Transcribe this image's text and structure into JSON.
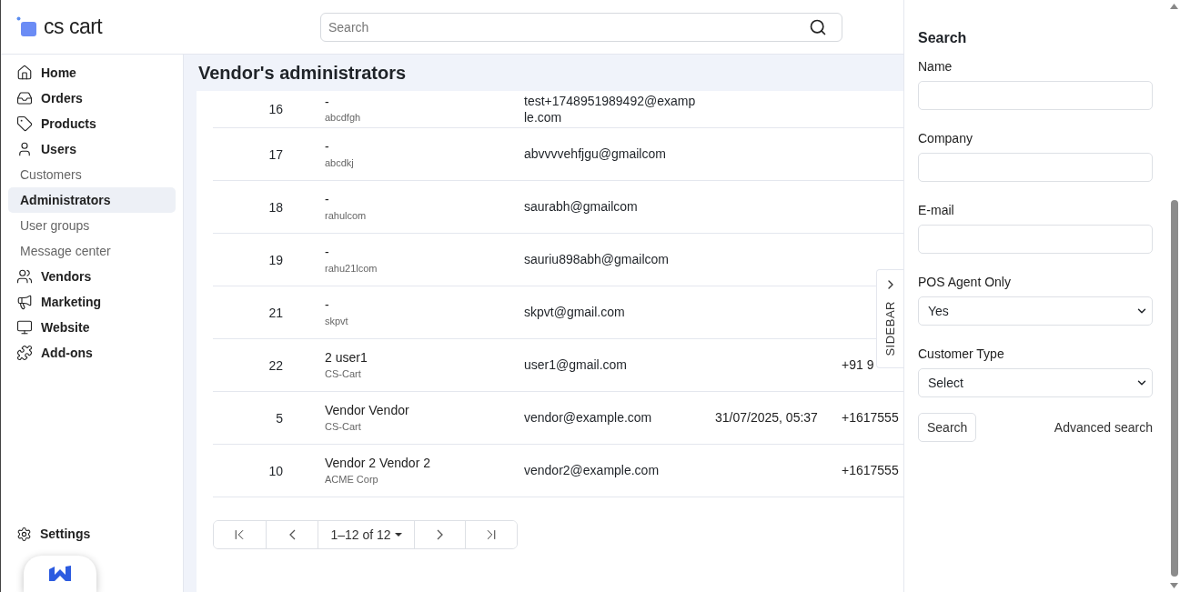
{
  "logo": {
    "text": "cs cart"
  },
  "search": {
    "placeholder": "Search"
  },
  "nav": [
    {
      "label": "Home",
      "kind": "main",
      "selected": false
    },
    {
      "label": "Orders",
      "kind": "main",
      "selected": false
    },
    {
      "label": "Products",
      "kind": "main",
      "selected": false
    },
    {
      "label": "Users",
      "kind": "main",
      "selected": false
    },
    {
      "label": "Customers",
      "kind": "sub",
      "selected": false
    },
    {
      "label": "Administrators",
      "kind": "sub",
      "selected": true
    },
    {
      "label": "User groups",
      "kind": "sub",
      "selected": false
    },
    {
      "label": "Message center",
      "kind": "sub",
      "selected": false
    },
    {
      "label": "Vendors",
      "kind": "main",
      "selected": false
    },
    {
      "label": "Marketing",
      "kind": "main",
      "selected": false
    },
    {
      "label": "Website",
      "kind": "main",
      "selected": false
    },
    {
      "label": "Add-ons",
      "kind": "main",
      "selected": false
    }
  ],
  "settings": {
    "label": "Settings"
  },
  "page_title": "Vendor's administrators",
  "table": {
    "rows": [
      {
        "id": "16",
        "name": "-",
        "company": "abcdfgh",
        "email": [
          "test+1748951989492@examp",
          "le.com"
        ]
      },
      {
        "id": "17",
        "name": "-",
        "company": "abcdkj",
        "email": [
          "abvvvvehfjgu@gmailcom"
        ]
      },
      {
        "id": "18",
        "name": "-",
        "company": "rahulcom",
        "email": [
          "saurabh@gmailcom"
        ]
      },
      {
        "id": "19",
        "name": "-",
        "company": "rahu21lcom",
        "email": [
          "sauriu898abh@gmailcom"
        ]
      },
      {
        "id": "21",
        "name": "-",
        "company": "skpvt",
        "email": [
          "skpvt@gmail.com"
        ]
      },
      {
        "id": "22",
        "name": "2 user1",
        "company": "CS-Cart",
        "email": [
          "user1@gmail.com"
        ],
        "phone": "+91 9"
      },
      {
        "id": "5",
        "name": "Vendor Vendor",
        "company": "CS-Cart",
        "email": [
          "vendor@example.com"
        ],
        "last_login": "31/07/2025, 05:37",
        "phone": "+1617555"
      },
      {
        "id": "10",
        "name": "Vendor 2 Vendor 2",
        "company": "ACME Corp",
        "email": [
          "vendor2@example.com"
        ],
        "phone": "+1617555"
      }
    ]
  },
  "pagination": {
    "range": "1–12 of 12"
  },
  "sidebar_toggle": {
    "label": "SIDEBAR"
  },
  "search_panel": {
    "title": "Search",
    "fields": [
      {
        "label": "Name",
        "kind": "text"
      },
      {
        "label": "Company",
        "kind": "text"
      },
      {
        "label": "E-mail",
        "kind": "text"
      },
      {
        "label": "POS Agent Only",
        "kind": "select",
        "value": "Yes"
      },
      {
        "label": "Customer Type",
        "kind": "select",
        "value": "Select"
      }
    ],
    "button": "Search",
    "link": "Advanced search"
  }
}
